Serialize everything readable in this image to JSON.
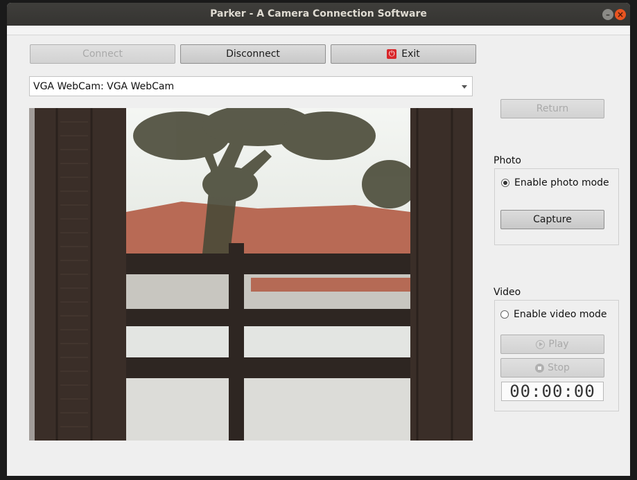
{
  "window": {
    "title": "Parker - A Camera Connection Software"
  },
  "toolbar": {
    "connect_label": "Connect",
    "disconnect_label": "Disconnect",
    "exit_label": "Exit"
  },
  "camera_select": {
    "selected": "VGA WebCam: VGA WebCam"
  },
  "side": {
    "return_label": "Return",
    "photo": {
      "group_title": "Photo",
      "enable_label": "Enable photo mode",
      "enabled": true,
      "capture_label": "Capture"
    },
    "video": {
      "group_title": "Video",
      "enable_label": "Enable video mode",
      "enabled": false,
      "play_label": "Play",
      "stop_label": "Stop",
      "timer": "00:00:00"
    }
  },
  "icons": {
    "exit": "power-icon",
    "play": "play-circle-icon",
    "stop": "stop-circle-icon",
    "combo": "chevron-down-icon"
  },
  "colors": {
    "title_bar": "#3c3b37",
    "close_button": "#e95420",
    "window_bg": "#efefef",
    "exit_icon": "#d8262a"
  }
}
